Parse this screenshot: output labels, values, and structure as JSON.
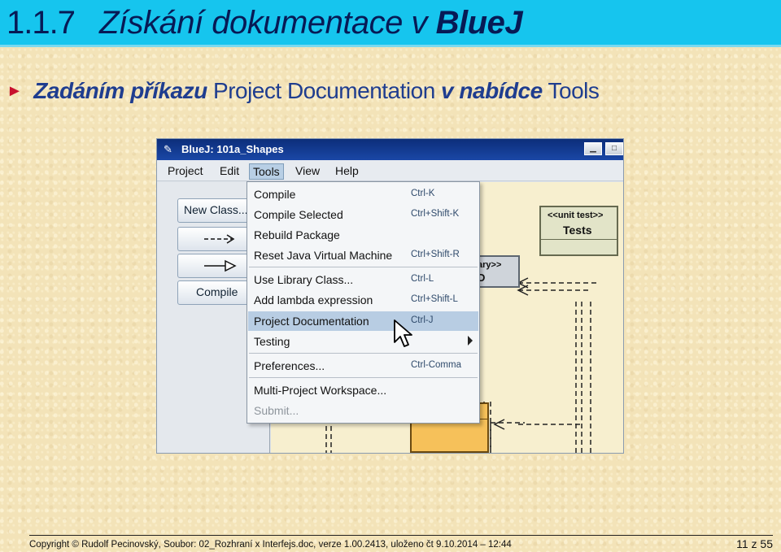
{
  "slide": {
    "number": "1.1.7",
    "title_regular": "Získání dokumentace v ",
    "title_strong": "BlueJ",
    "bullet": {
      "part1": "Zadáním příkazu",
      "part2": " Project Documentation ",
      "part3": "v nabídce",
      "part4": " Tools"
    }
  },
  "app": {
    "window_title": "BlueJ:  101a_Shapes",
    "app_icon": "bluej-bird-icon",
    "window_buttons": [
      "minimize",
      "maximize"
    ],
    "menubar": [
      "Project",
      "Edit",
      "Tools",
      "View",
      "Help"
    ],
    "active_menu": "Tools",
    "left_buttons": [
      "New Class...",
      "dependency-arrow",
      "inheritance-arrow",
      "Compile"
    ],
    "unit_test_class": {
      "stereotype": "<<unit test>>",
      "name": "Tests"
    },
    "library_class_fragment": {
      "stereotype": "ary>>",
      "name": "D"
    },
    "tools_menu": [
      {
        "label": "Compile",
        "shortcut": "Ctrl-K"
      },
      {
        "label": "Compile Selected",
        "shortcut": "Ctrl+Shift-K"
      },
      {
        "label": "Rebuild Package",
        "shortcut": ""
      },
      {
        "label": "Reset Java Virtual Machine",
        "shortcut": "Ctrl+Shift-R"
      },
      {
        "label": "Use Library Class...",
        "shortcut": "Ctrl-L"
      },
      {
        "label": "Add lambda expression",
        "shortcut": "Ctrl+Shift-L"
      },
      {
        "label": "Project Documentation",
        "shortcut": "Ctrl-J",
        "highlighted": true
      },
      {
        "label": "Testing",
        "shortcut": "",
        "submenu": true
      },
      {
        "label": "Preferences...",
        "shortcut": "Ctrl-Comma"
      },
      {
        "label": "Multi-Project Workspace...",
        "shortcut": ""
      },
      {
        "label": "Submit...",
        "shortcut": "",
        "disabled": true
      }
    ]
  },
  "footer": {
    "copyright": "Copyright © Rudolf Pecinovský, Soubor: 02_Rozhraní x Interfejs.doc, verze 1.00.2413, uloženo čt 9.10.2014 – 12:44",
    "page": "11 z 55"
  },
  "colors": {
    "title_bar": "#16c5ee",
    "title_text": "#071a55",
    "bullet_text": "#1f3d8f",
    "bullet_arrow": "#c8102e",
    "menu_highlight": "#b8cde3",
    "window_title_bar": "#1a47a6"
  }
}
